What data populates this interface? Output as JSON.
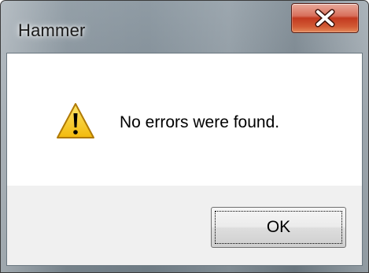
{
  "window": {
    "title": "Hammer",
    "close_icon": "close-icon"
  },
  "dialog": {
    "icon": "warning-icon",
    "message": "No errors were found.",
    "ok_label": "OK"
  },
  "colors": {
    "close_button": "#c8432a",
    "warning_fill": "#f4c414",
    "button_area": "#f0f0f0"
  }
}
